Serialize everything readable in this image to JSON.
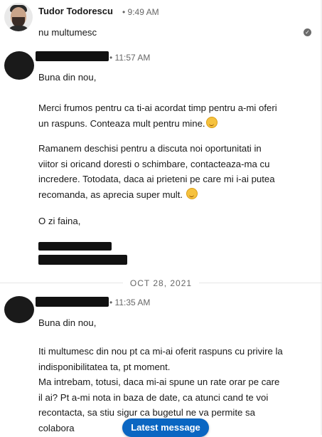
{
  "messages": [
    {
      "sender": "Tudor Todorescu",
      "time": "• 9:49 AM",
      "text": "nu multumesc"
    },
    {
      "time": "• 11:57 AM",
      "text": "Buna din nou,\n\nMerci frumos pentru ca ti-ai acordat timp pentru a-mi oferi un raspuns. Conteaza mult pentru mine.",
      "text2": "Ramanem deschisi pentru a discuta noi oportunitati in viitor si oricand doresti o schimbare, contacteaza-ma cu incredere. Totodata, daca ai prieteni pe care mi i-ai putea recomanda, as aprecia super mult.",
      "text3": "O zi faina,"
    },
    {
      "time": "• 11:35 AM",
      "text": "Buna din nou,",
      "text2": "Iti multumesc din nou pt ca mi-ai oferit raspuns cu privire la indisponibilitatea ta, pt moment.\nMa intrebam, totusi, daca mi-ai spune un rate orar pe care il ai? Pt a-mi nota in baza de date, ca atunci cand te voi recontacta, sa stiu sigur ca bugetul ne va permite sa colabora"
    }
  ],
  "date_divider": "OCT 28, 2021",
  "latest_message_label": "Latest message",
  "read_icon": "check-circle-icon",
  "colors": {
    "accent": "#0a66c2",
    "time_text": "#666666"
  }
}
